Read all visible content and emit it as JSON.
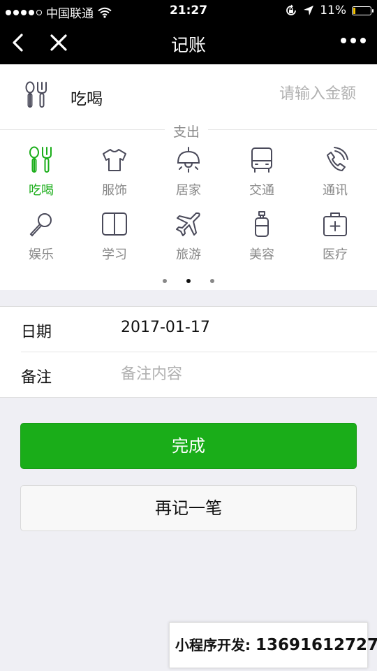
{
  "status_bar": {
    "carrier": "中国联通",
    "time": "21:27",
    "battery_percent": "11%",
    "battery_level": 0.11,
    "signal_bars": 4,
    "icons": [
      "signal-dots-icon",
      "wifi-icon",
      "rotation-lock-icon",
      "location-arrow-icon",
      "battery-icon"
    ]
  },
  "nav": {
    "title": "记账",
    "back_icon": "chevron-left-icon",
    "close_icon": "close-icon",
    "more_icon": "more-dots-icon"
  },
  "amount": {
    "category": "吃喝",
    "category_icon": "fork-spoon-icon",
    "placeholder": "请输入金额"
  },
  "section": {
    "label": "支出"
  },
  "categories": [
    {
      "label": "吃喝",
      "icon": "fork-spoon-icon",
      "active": true
    },
    {
      "label": "服饰",
      "icon": "tshirt-icon",
      "active": false
    },
    {
      "label": "居家",
      "icon": "ceiling-lamp-icon",
      "active": false
    },
    {
      "label": "交通",
      "icon": "bus-icon",
      "active": false
    },
    {
      "label": "通讯",
      "icon": "phone-icon",
      "active": false
    },
    {
      "label": "娱乐",
      "icon": "microphone-icon",
      "active": false
    },
    {
      "label": "学习",
      "icon": "book-icon",
      "active": false
    },
    {
      "label": "旅游",
      "icon": "airplane-icon",
      "active": false
    },
    {
      "label": "美容",
      "icon": "lotion-bottle-icon",
      "active": false
    },
    {
      "label": "医疗",
      "icon": "medical-kit-icon",
      "active": false
    }
  ],
  "pager": {
    "pages": 3,
    "current": 2
  },
  "form": {
    "date_label": "日期",
    "date_value": "2017-01-17",
    "note_label": "备注",
    "note_placeholder": "备注内容"
  },
  "buttons": {
    "done": "完成",
    "again": "再记一笔"
  },
  "promo": {
    "label": "小程序开发:",
    "phone": "13691612727"
  },
  "colors": {
    "accent": "#1aad19",
    "icon_gray": "#4a4a5a",
    "label_gray": "#888888",
    "background": "#efeff4"
  }
}
